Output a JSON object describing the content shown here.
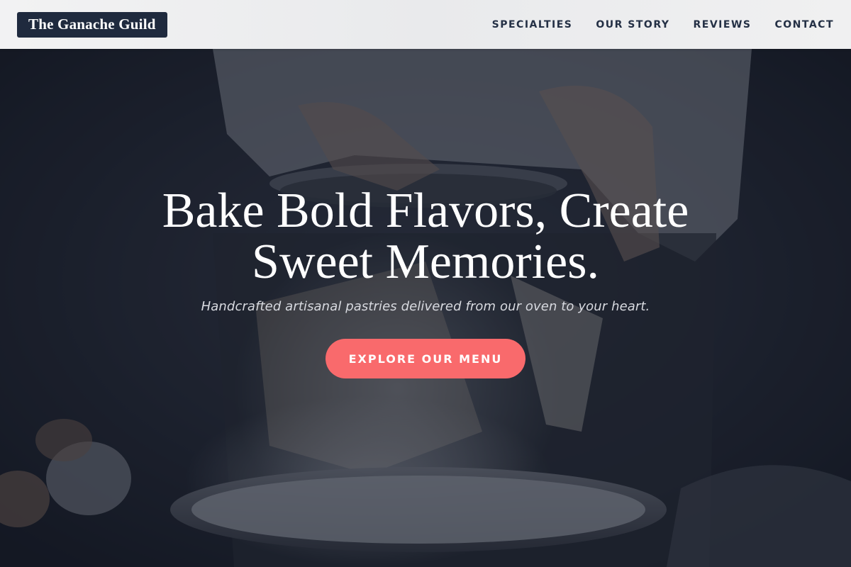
{
  "header": {
    "logo_text": "The Ganache Guild",
    "nav": [
      {
        "label": "SPECIALTIES"
      },
      {
        "label": "OUR STORY"
      },
      {
        "label": "REVIEWS"
      },
      {
        "label": "CONTACT"
      }
    ]
  },
  "hero": {
    "headline": "Bake Bold Flavors, Create Sweet Memories.",
    "subheadline": "Handcrafted artisanal pastries delivered from our oven to your heart.",
    "cta_label": "EXPLORE OUR MENU",
    "background_image": "baker-sifting-flour-photo"
  },
  "colors": {
    "logo_bg": "#1f2a3e",
    "nav_text": "#243045",
    "cta_bg": "#f96a6c",
    "overlay": "#161b28"
  }
}
